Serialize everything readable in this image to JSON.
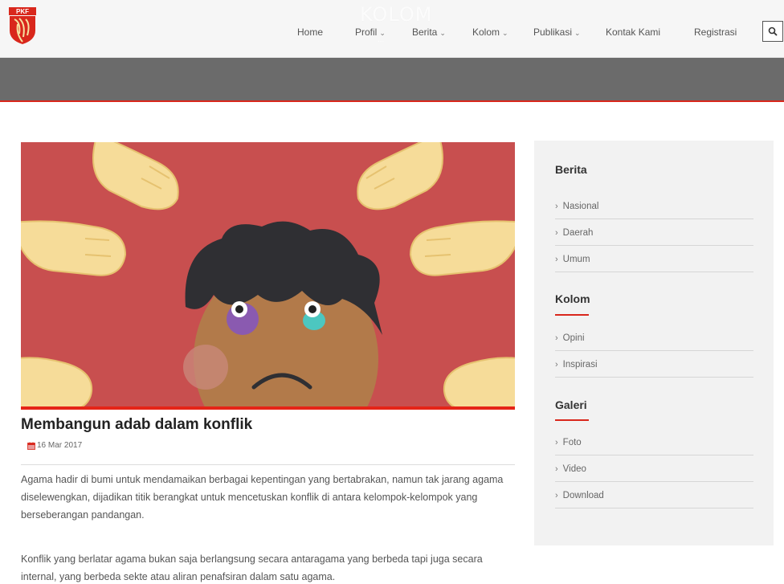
{
  "header": {
    "ghost_title": "KOLOM",
    "ghost_sub": "...",
    "nav": [
      {
        "label": "Home",
        "has_dropdown": false
      },
      {
        "label": "Profil",
        "has_dropdown": true
      },
      {
        "label": "Berita",
        "has_dropdown": true
      },
      {
        "label": "Kolom",
        "has_dropdown": true
      },
      {
        "label": "Publikasi",
        "has_dropdown": true
      },
      {
        "label": "Kontak Kami",
        "has_dropdown": false
      },
      {
        "label": "Registrasi",
        "has_dropdown": false
      }
    ],
    "search_icon": "search-icon",
    "logo_text": "PKF"
  },
  "colors": {
    "accent_red": "#d9271c",
    "banner_gray": "#6b6b6b",
    "hero_background": "#c84f4f"
  },
  "article": {
    "title": "Membangun adab dalam konflik",
    "date": "16 Mar 2017",
    "paragraphs": [
      "Agama hadir di bumi untuk mendamaikan berbagai kepentingan yang bertabrakan, namun tak jarang agama diselewengkan, dijadikan titik berangkat untuk mencetuskan konflik di antara kelompok-kelompok yang berseberangan pandangan.",
      "Konflik yang berlatar agama bukan saja berlangsung secara antaragama yang berbeda tapi juga secara internal, yang berbeda sekte atau aliran penafsiran dalam satu agama."
    ]
  },
  "sidebar": {
    "sections": [
      {
        "heading": "Berita",
        "items": [
          "Nasional",
          "Daerah",
          "Umum"
        ]
      },
      {
        "heading": "Kolom",
        "items": [
          "Opini",
          "Inspirasi"
        ]
      },
      {
        "heading": "Galeri",
        "items": [
          "Foto",
          "Video",
          "Download"
        ]
      }
    ]
  }
}
